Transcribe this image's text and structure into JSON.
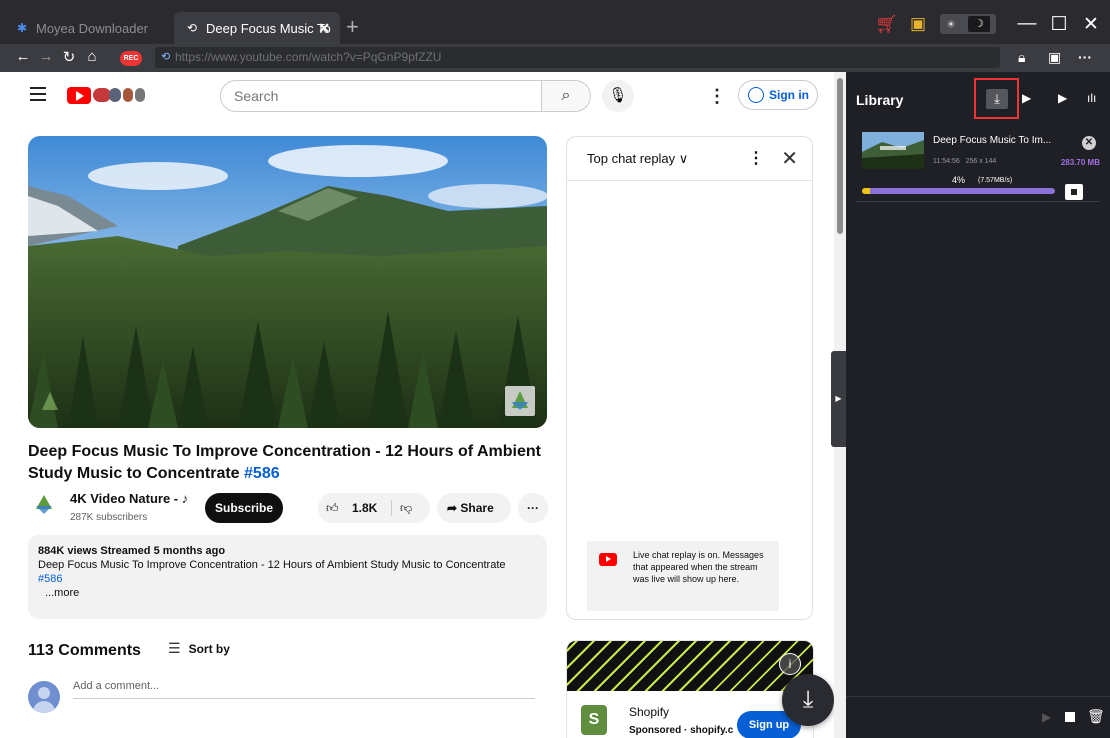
{
  "tabs": [
    {
      "label": "Moyea Downloader",
      "icon": "moyea-logo-icon"
    },
    {
      "label": "Deep Focus Music To",
      "icon": "link-icon",
      "close": "✕"
    }
  ],
  "addressbar": {
    "rec": "REC",
    "url": "https://www.youtube.com/watch?v=PqGnP9pfZZU"
  },
  "youtube": {
    "search_placeholder": "Search",
    "signin": "Sign in"
  },
  "video": {
    "title": "Deep Focus Music To Improve Concentration - 12 Hours of Ambient Study Music to Concentrate ",
    "hashtag": "#586",
    "channel": "4K Video Nature - ♪",
    "subscribers": "287K subscribers",
    "subscribe": "Subscribe",
    "likes": "1.8K",
    "share": "Share",
    "more": "···"
  },
  "description": {
    "stats": "884K views  Streamed 5 months ago",
    "text": "Deep Focus Music To Improve Concentration - 12 Hours of Ambient Study Music to Concentrate",
    "tag": "#586",
    "more": "...more"
  },
  "comments": {
    "count": "113 Comments",
    "sort": "Sort by",
    "placeholder": "Add a comment..."
  },
  "chat": {
    "title": "Top chat replay ∨",
    "note": "Live chat replay is on. Messages that appeared when the stream was live will show up here."
  },
  "ad": {
    "name": "Shopify",
    "sponsored": "Sponsored · shopify.c",
    "cta": "Sign up"
  },
  "library": {
    "title": "Library",
    "task": {
      "title": "Deep Focus Music To Im...",
      "duration": "11:54:56",
      "resolution": "256 x 144",
      "size": "283.70 MB",
      "percent": "4%",
      "speed": "(7.57MB/s)",
      "progress": 0.04
    }
  },
  "colors": {
    "accent_purple": "#8a72d8",
    "progress_yellow": "#f1c40f",
    "link_blue": "#065fd4"
  }
}
